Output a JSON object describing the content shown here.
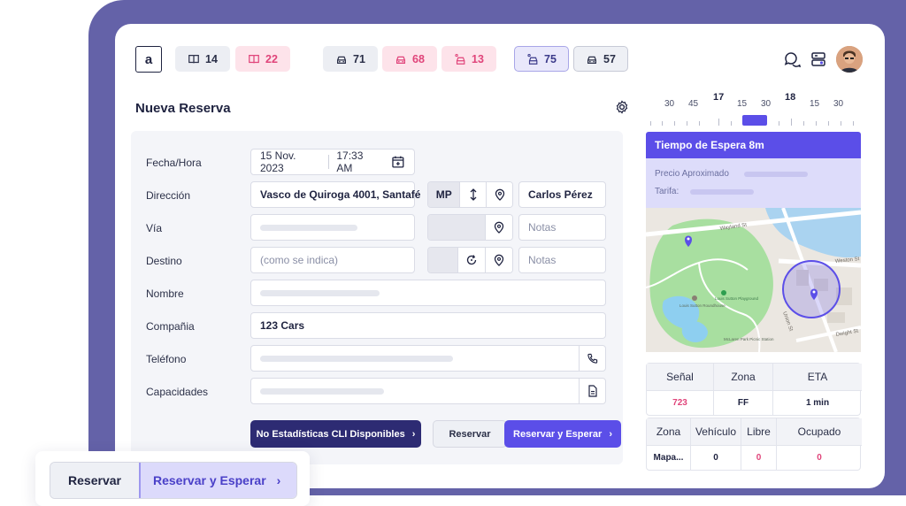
{
  "topbar": {
    "logo": "a",
    "counters": [
      {
        "icon": "book-icon",
        "count": "14"
      },
      {
        "icon": "book-icon",
        "count": "22"
      },
      {
        "icon": "car-icon",
        "count": "71"
      },
      {
        "icon": "car-icon",
        "count": "68"
      },
      {
        "icon": "passenger-car-icon",
        "count": "13"
      },
      {
        "icon": "passenger-car-icon",
        "count": "75"
      },
      {
        "icon": "car-icon",
        "count": "57"
      }
    ]
  },
  "form": {
    "title": "Nueva Reserva",
    "labels": {
      "fecha": "Fecha/Hora",
      "direccion": "Dirección",
      "via": "Vía",
      "destino": "Destino",
      "nombre": "Nombre",
      "compania": "Compañia",
      "telefono": "Teléfono",
      "capacidades": "Capacidades"
    },
    "date": "15 Nov. 2023",
    "time": "17:33 AM",
    "direccion_value": "Vasco de Quiroga 4001, Santafé",
    "mp_label": "MP",
    "cliente": "Carlos Pérez",
    "notas_placeholder": "Notas",
    "destino_placeholder": "(como se indica)",
    "compania_value": "123 Cars",
    "btn_stats": "No Estadísticas CLI Disponibles",
    "btn_reservar": "Reservar",
    "btn_reservar_esperar": "Reservar y Esperar"
  },
  "ruler": {
    "labels": [
      "30",
      "45",
      "17",
      "15",
      "30",
      "18",
      "15",
      "30"
    ]
  },
  "wait": {
    "title": "Tiempo de Espera 8m",
    "precio": "Precio Aproximado",
    "tarifa": "Tarifa:"
  },
  "map": {
    "streets": [
      "Wayland St",
      "Weston St",
      "Union St",
      "Dwight St"
    ],
    "places": [
      "Louis Sutton Roundhouse",
      "Louis Sutton Playground",
      "McLaren Park Picnic Station"
    ]
  },
  "signal_table": {
    "headers": [
      "Señal",
      "Zona",
      "ETA"
    ],
    "values": [
      "723",
      "FF",
      "1 min"
    ]
  },
  "zone_table": {
    "headers": [
      "Zona",
      "Vehículo",
      "Libre",
      "Ocupado"
    ],
    "values": [
      "Mapa...",
      "0",
      "0",
      "0"
    ]
  },
  "floating": {
    "reservar": "Reservar",
    "reservar_esperar": "Reservar y Esperar"
  },
  "colors": {
    "frame": "#6462a8",
    "accent": "#5b4ee8",
    "navy": "#2d2b73",
    "pink": "#e0447a"
  }
}
